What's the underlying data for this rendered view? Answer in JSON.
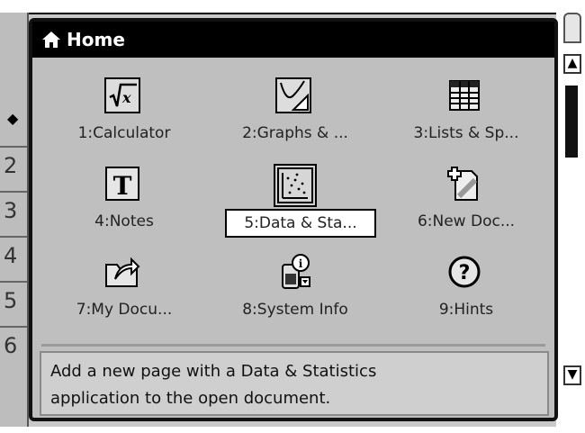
{
  "window": {
    "title": "Home"
  },
  "row_numbers": [
    "2",
    "3",
    "4",
    "5",
    "6"
  ],
  "apps": [
    {
      "label": "1:Calculator",
      "icon": "calculator-icon"
    },
    {
      "label": "2:Graphs & ...",
      "icon": "graphs-icon"
    },
    {
      "label": "3:Lists & Sp...",
      "icon": "lists-spreadsheet-icon"
    },
    {
      "label": "4:Notes",
      "icon": "notes-icon"
    },
    {
      "label": "5:Data & Sta...",
      "icon": "data-statistics-icon",
      "selected": true
    },
    {
      "label": "6:New Doc...",
      "icon": "new-document-icon"
    },
    {
      "label": "7:My Docu...",
      "icon": "my-documents-icon"
    },
    {
      "label": "8:System Info",
      "icon": "system-info-icon"
    },
    {
      "label": "9:Hints",
      "icon": "hints-icon"
    }
  ],
  "description": {
    "line1": "Add a new page with a Data & Statistics",
    "line2": "application to the open document."
  }
}
